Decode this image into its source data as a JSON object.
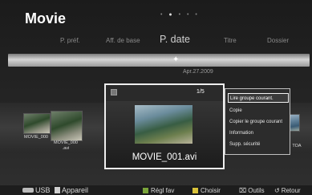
{
  "app": {
    "title": "Movie"
  },
  "tabs": [
    {
      "label": "P. préf.",
      "active": false
    },
    {
      "label": "Aff. de base",
      "active": false
    },
    {
      "label": "P. date",
      "active": true
    },
    {
      "label": "Titre",
      "active": false
    },
    {
      "label": "Dossier",
      "active": false
    }
  ],
  "timeline": {
    "date": "Apr.27.2009"
  },
  "strip": {
    "left_captions": [
      "MOVIE_000",
      "MOVIE_000 .avi"
    ],
    "right_caption": "TOA"
  },
  "focused": {
    "counter": "1/5",
    "filename": "MOVIE_001.avi"
  },
  "menu": {
    "items": [
      {
        "label": "Lire groupe courant.",
        "selected": true
      },
      {
        "label": "Copie",
        "selected": false
      },
      {
        "label": "Copier le groupe courant",
        "selected": false
      },
      {
        "label": "Information",
        "selected": false
      },
      {
        "label": "Supp. sécurité",
        "selected": false
      }
    ]
  },
  "bottom_bar": {
    "device_type": "USB",
    "device_label": "Appareil",
    "fav_label": "Régl fav",
    "choose_label": "Choisir",
    "tools_label": "Outils",
    "return_label": "Retour"
  },
  "colors": {
    "green_key": "#7aa43a",
    "yellow_key": "#d9c23a",
    "blue_key": "#4d79c7"
  }
}
